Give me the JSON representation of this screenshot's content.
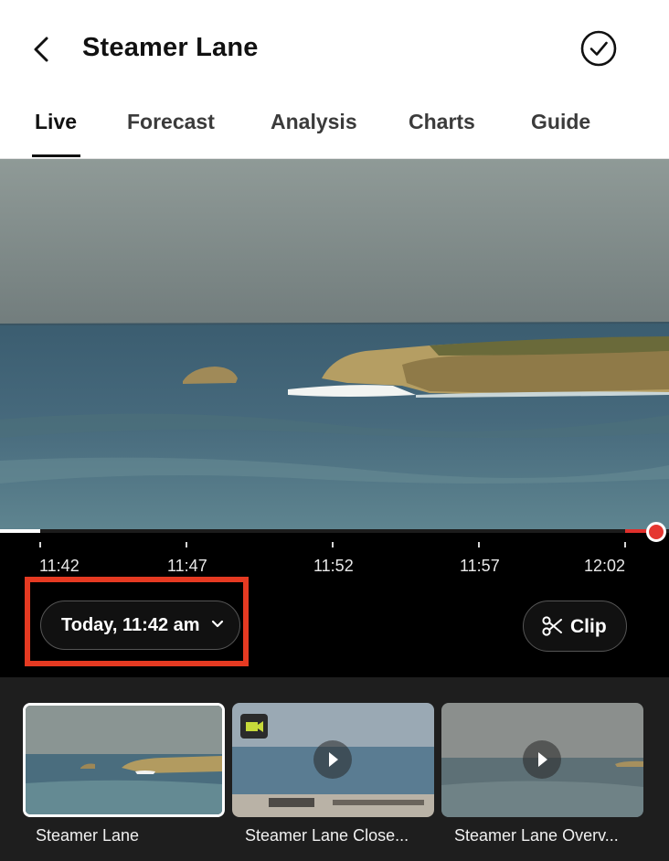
{
  "header": {
    "title": "Steamer Lane"
  },
  "tabs": [
    {
      "label": "Live",
      "active": true
    },
    {
      "label": "Forecast",
      "active": false
    },
    {
      "label": "Analysis",
      "active": false
    },
    {
      "label": "Charts",
      "active": false
    },
    {
      "label": "Guide",
      "active": false
    }
  ],
  "player": {
    "progress_fraction": 0.06,
    "time_labels": [
      "11:42",
      "11:47",
      "11:52",
      "11:57",
      "12:02"
    ],
    "date_selector": "Today, 11:42 am",
    "clip_label": "Clip"
  },
  "cameras": [
    {
      "label": "Steamer Lane",
      "selected": true
    },
    {
      "label": "Steamer Lane Close...",
      "selected": false
    },
    {
      "label": "Steamer Lane Overv...",
      "selected": false
    }
  ],
  "colors": {
    "live_red": "#e53630",
    "highlight": "#e53a22",
    "background_dark": "#000000"
  },
  "icons": [
    "back-arrow-icon",
    "check-circle-icon",
    "chevron-down-icon",
    "scissors-icon",
    "play-icon",
    "closeup-camera-icon"
  ]
}
